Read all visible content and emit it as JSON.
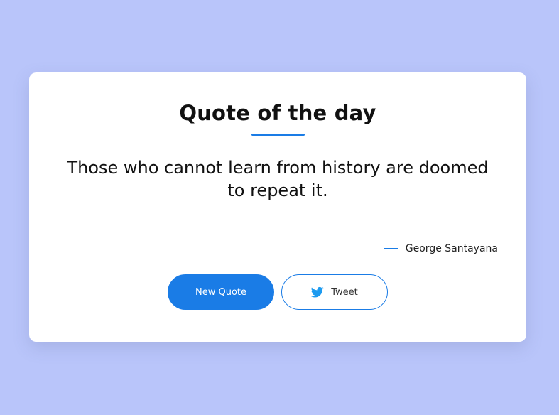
{
  "card": {
    "title": "Quote of the day",
    "quote": "Those who cannot learn from history are doomed to repeat it.",
    "author": "George Santayana"
  },
  "buttons": {
    "new_quote_label": "New Quote",
    "tweet_label": "Tweet",
    "tweet_icon": "twitter-bird-icon"
  },
  "colors": {
    "background": "#b9c5fa",
    "accent": "#1a7ce6",
    "card": "#ffffff",
    "twitter": "#1d9bf0"
  }
}
